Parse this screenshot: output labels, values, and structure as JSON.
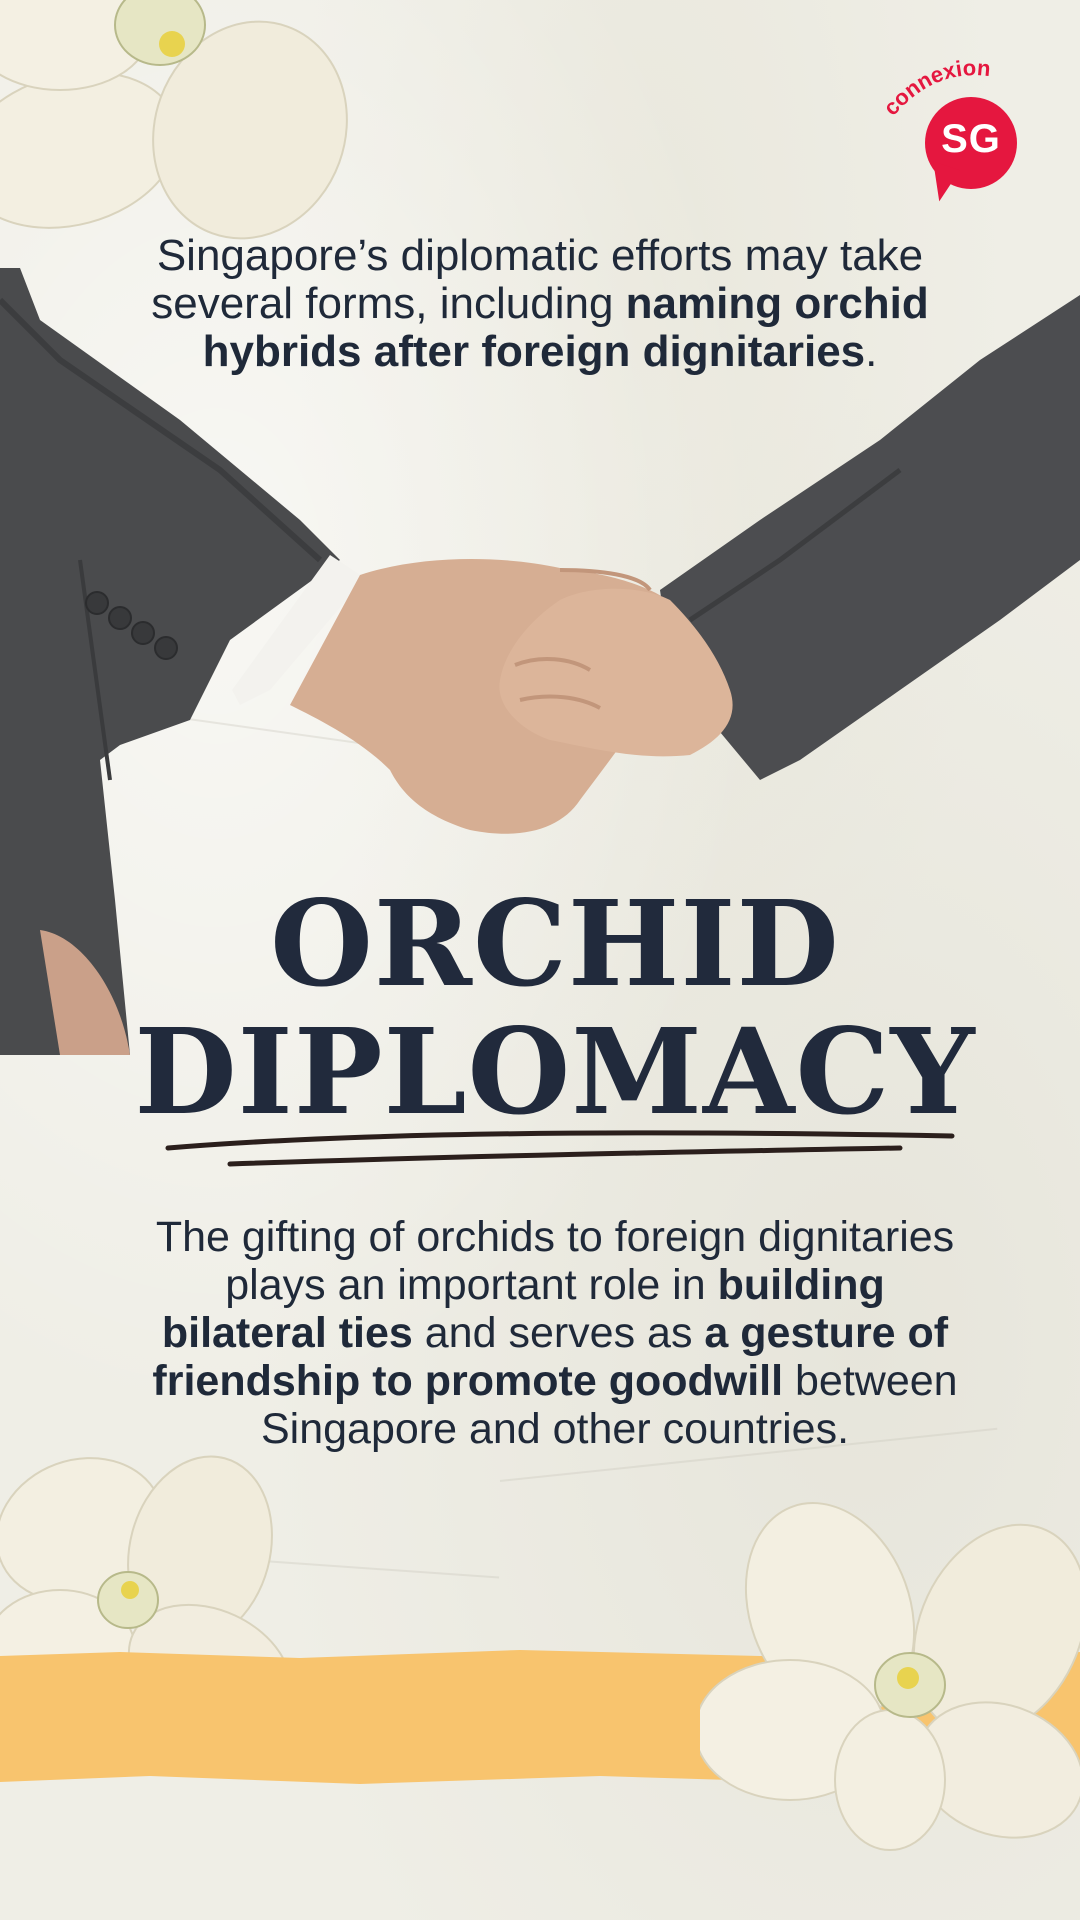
{
  "brand": {
    "logo_word": "connexion",
    "logo_mark": "SG",
    "accent_color": "#e5173f"
  },
  "intro": {
    "part1": "Singapore’s diplomatic efforts may take several forms, including ",
    "bold": "naming orchid hybrids after foreign dignitaries",
    "part2": "."
  },
  "title": {
    "line1": "ORCHID",
    "line2": "DIPLOMACY"
  },
  "body": {
    "part1": "The gifting of orchids to foreign dignitaries plays an important role in ",
    "bold1": "building bilateral ties",
    "part2": " and serves as ",
    "bold2": "a gesture of friendship to promote goodwill",
    "part3": " between Singapore and other countries."
  },
  "colors": {
    "text": "#212a3c",
    "background": "#efeee6",
    "tape": "#f8c46e"
  },
  "icons": [
    "handshake-illustration",
    "orchid-flower-icon",
    "connexion-sg-logo"
  ]
}
